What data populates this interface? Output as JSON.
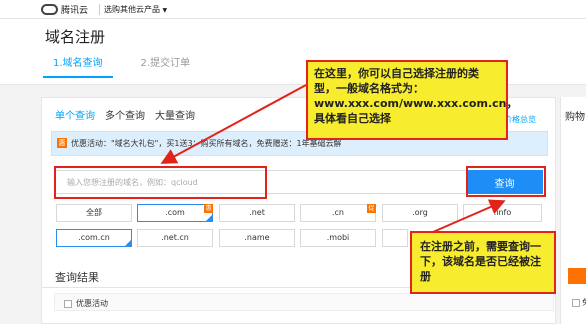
{
  "topbar": {
    "logo_text": "腾讯云",
    "nav_label": "选购其他云产品"
  },
  "header": {
    "page_title": "域名注册",
    "steps": [
      {
        "label": "1.域名查询",
        "active": true
      },
      {
        "label": "2.提交订单",
        "active": false
      }
    ]
  },
  "search": {
    "tabs": [
      {
        "label": "单个查询",
        "active": true
      },
      {
        "label": "多个查询",
        "active": false
      },
      {
        "label": "大量查询",
        "active": false
      }
    ],
    "side_link": "价格总览",
    "promo_text": "优惠活动：\"域名大礼包\"，买1送3：购买所有域名，免费赠送：1年基础云解析、1年域名型(DV)SSL证书和7大体验版建站模板",
    "promo_badge": "惠",
    "placeholder": "输入您想注册的域名，例如：qcloud",
    "button_label": "查询"
  },
  "suffixes": [
    {
      "label": "全部",
      "selected": false,
      "badge": ""
    },
    {
      "label": ".com",
      "selected": true,
      "badge": "惠"
    },
    {
      "label": ".net",
      "selected": false,
      "badge": ""
    },
    {
      "label": ".cn",
      "selected": false,
      "badge": "促"
    },
    {
      "label": ".org",
      "selected": false,
      "badge": ""
    },
    {
      "label": ".info",
      "selected": false,
      "badge": ""
    },
    {
      "label": ".com.cn",
      "selected": true,
      "badge": ""
    },
    {
      "label": ".net.cn",
      "selected": false,
      "badge": ""
    },
    {
      "label": ".name",
      "selected": false,
      "badge": ""
    },
    {
      "label": ".mobi",
      "selected": false,
      "badge": ""
    },
    {
      "label": "",
      "selected": false,
      "badge": ""
    },
    {
      "label": "",
      "selected": false,
      "badge": ""
    }
  ],
  "results": {
    "title": "查询结果",
    "promo_checkbox_label": "优惠活动"
  },
  "side": {
    "title": "购物",
    "checkbox_label": "免"
  },
  "annotations": {
    "callout_1": "在这里，你可以自己选择注册的类型，一般域名格式为：www.xxx.com/www.xxx.com.cn，具体看自己选择",
    "callout_2": "在注册之前，需要查询一下，该域名是否已经被注册"
  },
  "colors": {
    "accent": "#00a4ff",
    "button": "#1e8ef6",
    "highlight_red": "#e2231a",
    "callout_yellow": "#f7ec2e",
    "promo_orange": "#ff7200"
  }
}
